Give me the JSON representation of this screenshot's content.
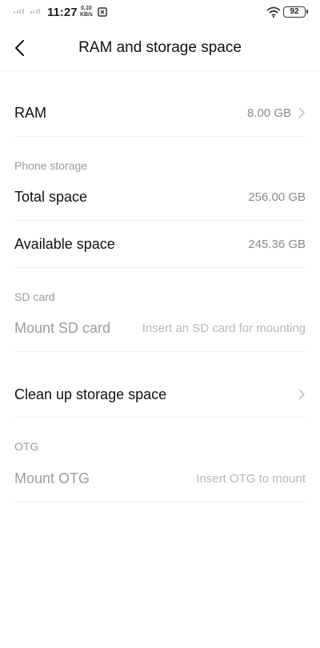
{
  "status_bar": {
    "time": "11:27",
    "net_speed_value": "0.10",
    "net_speed_unit": "KB/s",
    "battery": "92"
  },
  "header": {
    "title": "RAM and storage space"
  },
  "ram": {
    "label": "RAM",
    "value": "8.00 GB"
  },
  "phone_storage": {
    "section_label": "Phone storage",
    "total_label": "Total space",
    "total_value": "256.00 GB",
    "available_label": "Available space",
    "available_value": "245.36 GB"
  },
  "sd_card": {
    "section_label": "SD card",
    "mount_label": "Mount SD card",
    "mount_hint": "Insert an SD card for mounting"
  },
  "cleanup": {
    "label": "Clean up storage space"
  },
  "otg": {
    "section_label": "OTG",
    "mount_label": "Mount OTG",
    "mount_hint": "Insert OTG to mount"
  }
}
